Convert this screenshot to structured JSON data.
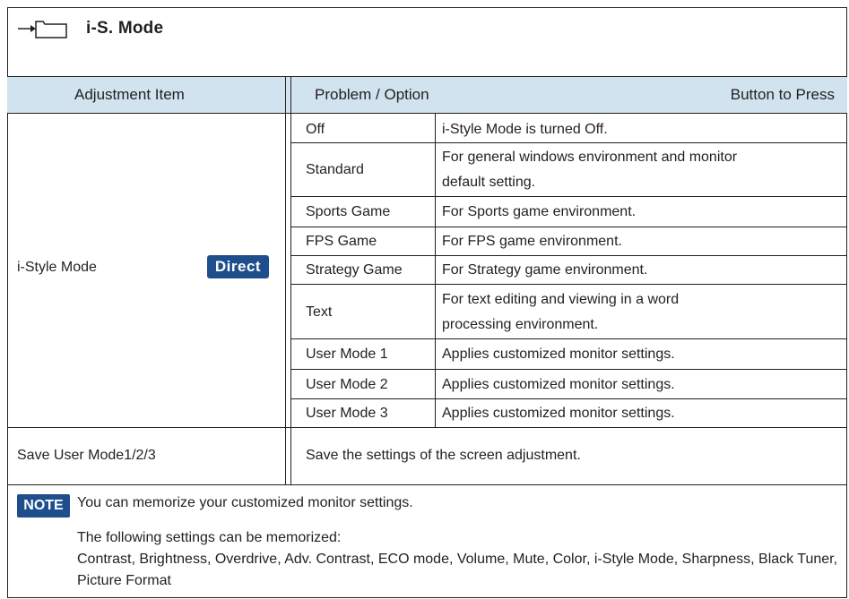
{
  "section": {
    "title": "i-S. Mode",
    "icon": "arrow-into-folder-icon"
  },
  "header": {
    "adjustment_item": "Adjustment Item",
    "problem_option": "Problem / Option",
    "button_to_press": "Button to Press"
  },
  "istyle": {
    "label": "i-Style Mode",
    "badge": "Direct",
    "rows": [
      {
        "option": "Off",
        "desc": "i-Style Mode is turned Off."
      },
      {
        "option": "Standard",
        "desc": "For general windows environment and monitor",
        "desc2": "default setting."
      },
      {
        "option": "Sports Game",
        "desc": "For Sports game environment."
      },
      {
        "option": "FPS Game",
        "desc": "For FPS game environment."
      },
      {
        "option": "Strategy Game",
        "desc": "For Strategy game environment."
      },
      {
        "option": "Text",
        "desc": "For text editing and viewing in a word",
        "desc2": "processing environment."
      },
      {
        "option": "User Mode 1",
        "desc": "Applies customized monitor settings."
      },
      {
        "option": "User Mode 2",
        "desc": "Applies customized monitor settings."
      },
      {
        "option": "User Mode 3",
        "desc": "Applies customized monitor settings."
      }
    ]
  },
  "save": {
    "label": "Save User Mode1/2/3",
    "desc": "Save the settings of the screen adjustment."
  },
  "note": {
    "badge": "NOTE",
    "text": "You can memorize your customized monitor settings.",
    "sub1": "The following settings can be memorized:",
    "sub2": "Contrast, Brightness, Overdrive, Adv. Contrast, ECO mode, Volume, Mute, Color, i-Style Mode, Sharpness, Black Tuner, Picture Format"
  },
  "colors": {
    "header_bg": "#d0e3ef",
    "badge_bg": "#1f4e8c"
  }
}
